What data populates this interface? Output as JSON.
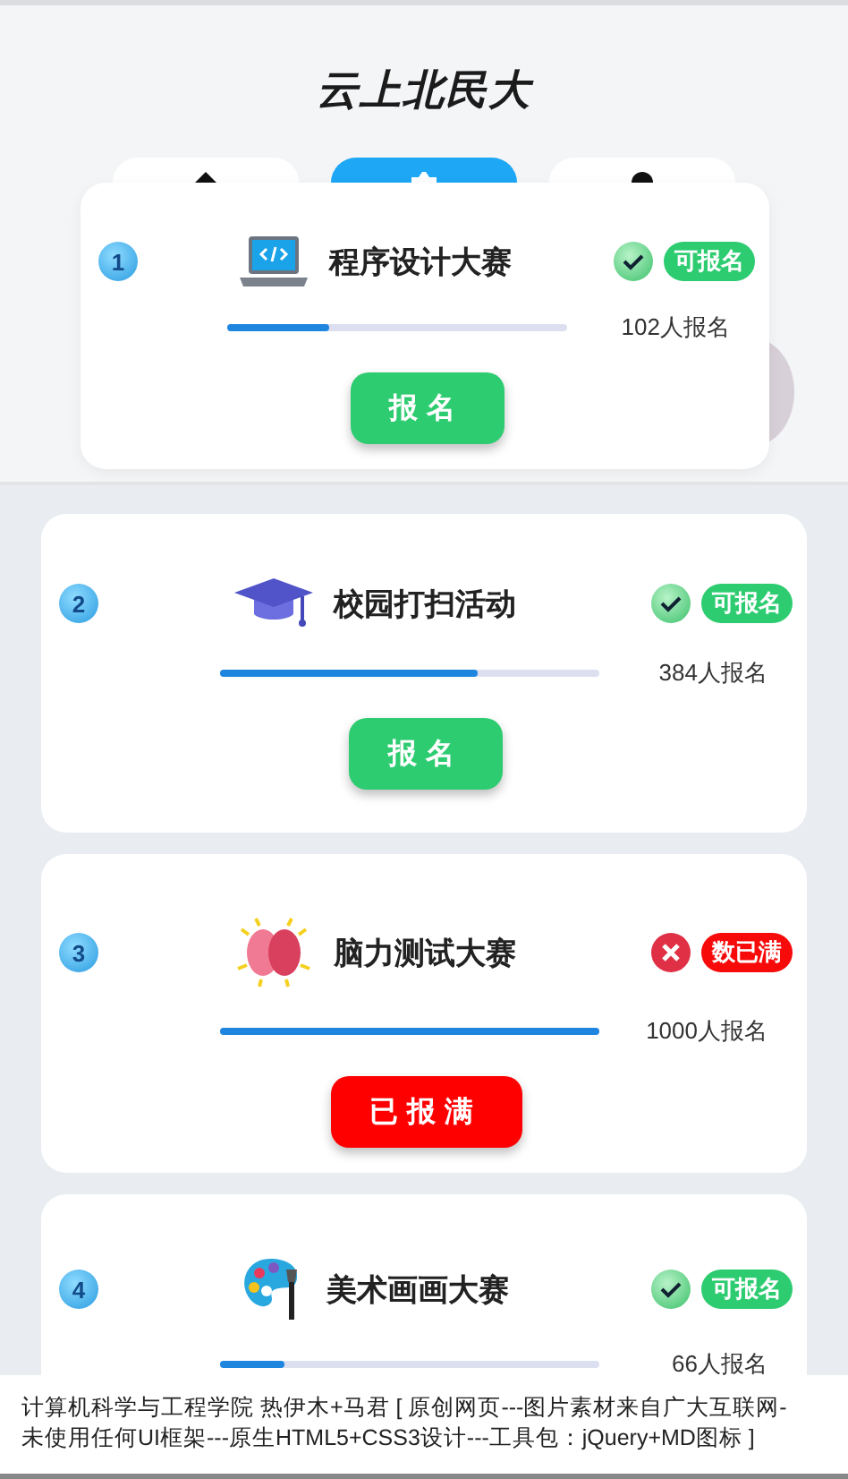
{
  "header": {
    "title": "云上北民大",
    "tabs": [
      {
        "selected": false
      },
      {
        "selected": true
      },
      {
        "selected": false
      }
    ]
  },
  "events": [
    {
      "number": "1",
      "title": "程序设计大赛",
      "available": true,
      "tag": "可报名",
      "count": "102人报名",
      "level": 0.3,
      "button": "报名"
    },
    {
      "number": "2",
      "title": "校园打扫活动",
      "available": true,
      "tag": "可报名",
      "count": "384人报名",
      "level": 0.68,
      "button": "报名"
    },
    {
      "number": "3",
      "title": "脑力测试大赛",
      "available": false,
      "tag": "数已满",
      "count": "1000人报名",
      "level": 1,
      "button": "已报满"
    },
    {
      "number": "4",
      "title": "美术画画大赛",
      "available": true,
      "tag": "可报名",
      "count": "66人报名",
      "level": 0.17
    }
  ],
  "footer": {
    "lines": [
      "计算机科学与工程学院 热伊木+马君 [ 原创网页---图片素材来自广大互联网-",
      "未使用任何UI框架---原生HTML5+CSS3设计---工具包：jQuery+MD图标 ]"
    ]
  }
}
